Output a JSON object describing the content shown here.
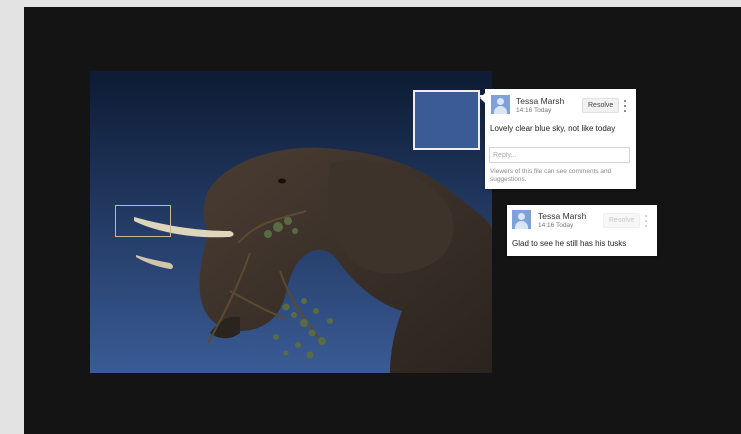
{
  "comments": [
    {
      "author": "Tessa Marsh",
      "time": "14:16 Today",
      "resolve_label": "Resolve",
      "text": "Lovely clear blue sky, not like today",
      "reply_placeholder": "Reply...",
      "notice": "Viewers of this file can see comments and suggestions."
    },
    {
      "author": "Tessa Marsh",
      "time": "14:16 Today",
      "resolve_label": "Resolve",
      "text": "Glad to see he still has his tusks"
    }
  ],
  "colors": {
    "viewer_background": "#141414",
    "sky_top": "#0d1b33",
    "sky_bottom": "#3a5b96",
    "avatar": "#7ea2d8",
    "active_region_border": "#f1efe4",
    "inactive_region_border": "#c9b98d"
  },
  "icons": {
    "avatar": "user-avatar-icon",
    "menu": "more-vertical-icon"
  }
}
